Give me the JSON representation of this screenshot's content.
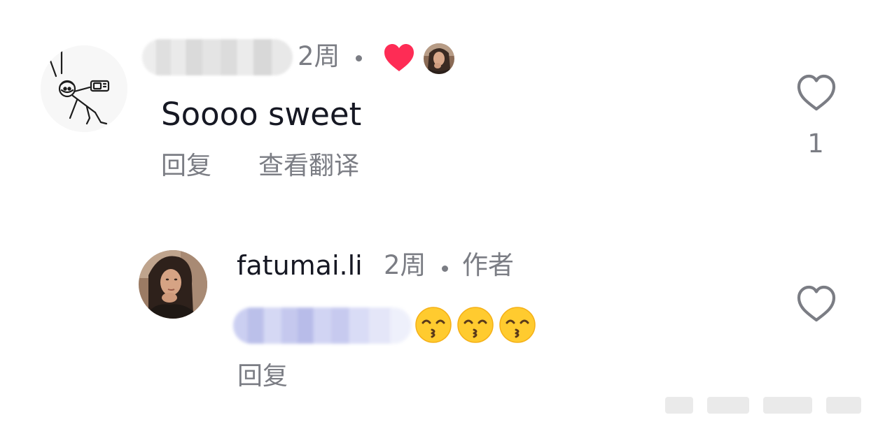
{
  "comments": [
    {
      "time": "2周",
      "text": "Soooo sweet",
      "reply_label": "回复",
      "translate_label": "查看翻译",
      "like_count": "1",
      "creator_liked": true
    },
    {
      "username": "fatumai.li",
      "time": "2周",
      "author_tag": "作者",
      "emojis": [
        "kissing-smiling-eyes",
        "kissing-smiling-eyes",
        "kissing-smiling-eyes"
      ],
      "reply_label": "回复"
    }
  ],
  "icons": {
    "creator_liked_heart": "heart-filled-icon",
    "like_button": "heart-outline-icon"
  },
  "colors": {
    "liked_heart": "#fe2c55",
    "secondary_text": "#7b7d84",
    "primary_text": "#161823"
  }
}
